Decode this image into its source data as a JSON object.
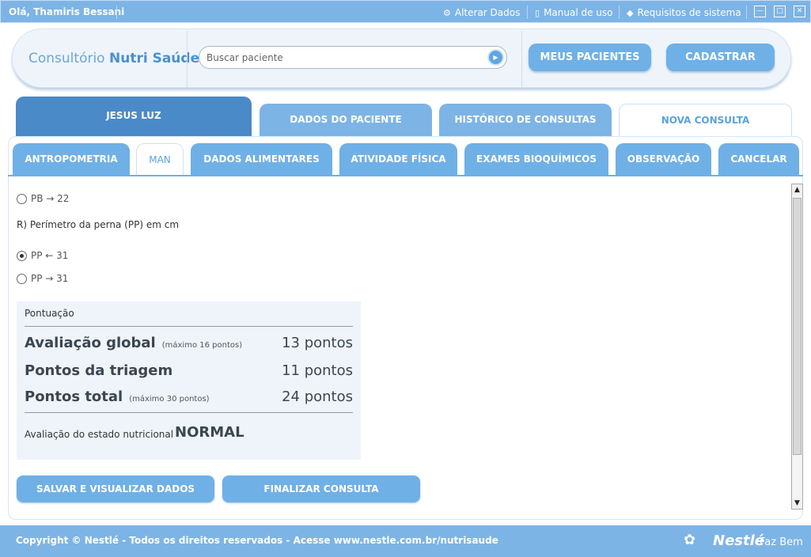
{
  "topbar": {
    "greeting": "Olá, Thamiris Bessani",
    "links": [
      {
        "label": "Alterar Dados",
        "icon": "user-gear-icon"
      },
      {
        "label": "Manual de uso",
        "icon": "book-icon"
      },
      {
        "label": "Requisitos de sistema",
        "icon": "tag-icon"
      }
    ]
  },
  "header": {
    "logo_prefix": "Consultório",
    "logo_brand": "Nutri Saúde",
    "search_placeholder": "Buscar paciente",
    "buttons": [
      "MEUS PACIENTES",
      "CADASTRAR"
    ]
  },
  "patient_tabs": {
    "patient_name": "JESUS LUZ",
    "tabs": [
      "DADOS DO PACIENTE",
      "HISTÓRICO DE CONSULTAS",
      "NOVA CONSULTA"
    ],
    "active": "NOVA CONSULTA"
  },
  "sub_tabs": {
    "items": [
      "ANTROPOMETRIA",
      "MAN",
      "DADOS ALIMENTARES",
      "ATIVIDADE FÍSICA",
      "EXAMES BIOQUÍMICOS",
      "OBSERVAÇÃO",
      "CANCELAR"
    ],
    "active": "MAN"
  },
  "form": {
    "pb_option": "PB → 22",
    "question_r": "R) Perímetro da perna (PP) em cm",
    "pp_options": [
      "PP ← 31",
      "PP → 31"
    ],
    "pp_selected": 0
  },
  "score": {
    "title": "Pontuação",
    "rows": [
      {
        "label": "Avaliação global",
        "note": "(máximo 16 pontos)",
        "value": "13 pontos"
      },
      {
        "label": "Pontos da triagem",
        "note": "",
        "value": "11 pontos"
      },
      {
        "label": "Pontos total",
        "note": "(máximo 30 pontos)",
        "value": "24 pontos"
      }
    ],
    "status_label": "Avaliação do estado nutricional",
    "status_value": "NORMAL"
  },
  "actions": {
    "save": "SALVAR E VISUALIZAR DADOS",
    "finish": "FINALIZAR CONSULTA"
  },
  "footer": {
    "copyright": "Copyright © Nestlé - Todos os direitos reservados - Acesse www.nestle.com.br/nutrisaude",
    "brand": "Nestlé",
    "tagline": "Faz Bem"
  },
  "colors": {
    "accent": "#7db4e6",
    "button": "#6fb0e6",
    "patient_tab": "#4a8ac8",
    "panel_bg": "#eef4fa"
  }
}
